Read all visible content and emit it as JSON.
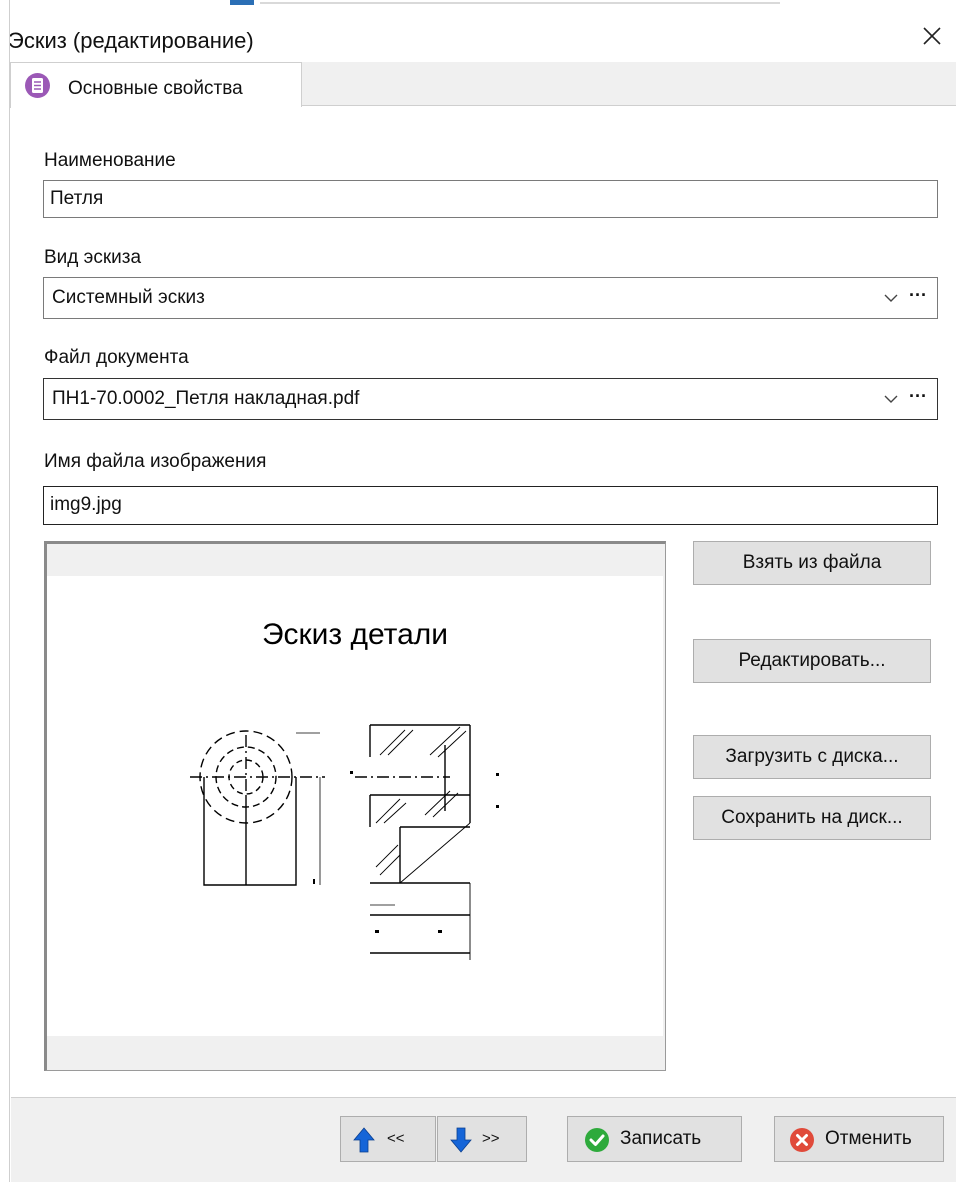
{
  "window": {
    "title": "Эскиз (редактирование)",
    "close_icon": "close-icon"
  },
  "tabs": [
    {
      "label": "Основные свойства",
      "icon": "properties-icon",
      "active": true,
      "icon_color": "#9b59b6"
    }
  ],
  "fields": {
    "name": {
      "label": "Наименование",
      "value": "Петля"
    },
    "sketch_type": {
      "label": "Вид эскиза",
      "value": "Системный эскиз"
    },
    "document_file": {
      "label": "Файл документа",
      "value": "ПН1-70.0002_Петля накладная.pdf"
    },
    "image_file_name": {
      "label": "Имя файла изображения",
      "value": "img9.jpg"
    }
  },
  "preview": {
    "caption": "Эскиз детали"
  },
  "side_buttons": {
    "take_from_file": "Взять из файла",
    "edit": "Редактировать...",
    "load_from_disk": "Загрузить с диска...",
    "save_to_disk": "Сохранить на диск..."
  },
  "footer": {
    "prev_label": "<<",
    "next_label": ">>",
    "save_label": "Записать",
    "cancel_label": "Отменить",
    "colors": {
      "arrow": "#1565d8",
      "save": "#2eaa3c",
      "cancel": "#e04a3a"
    }
  }
}
